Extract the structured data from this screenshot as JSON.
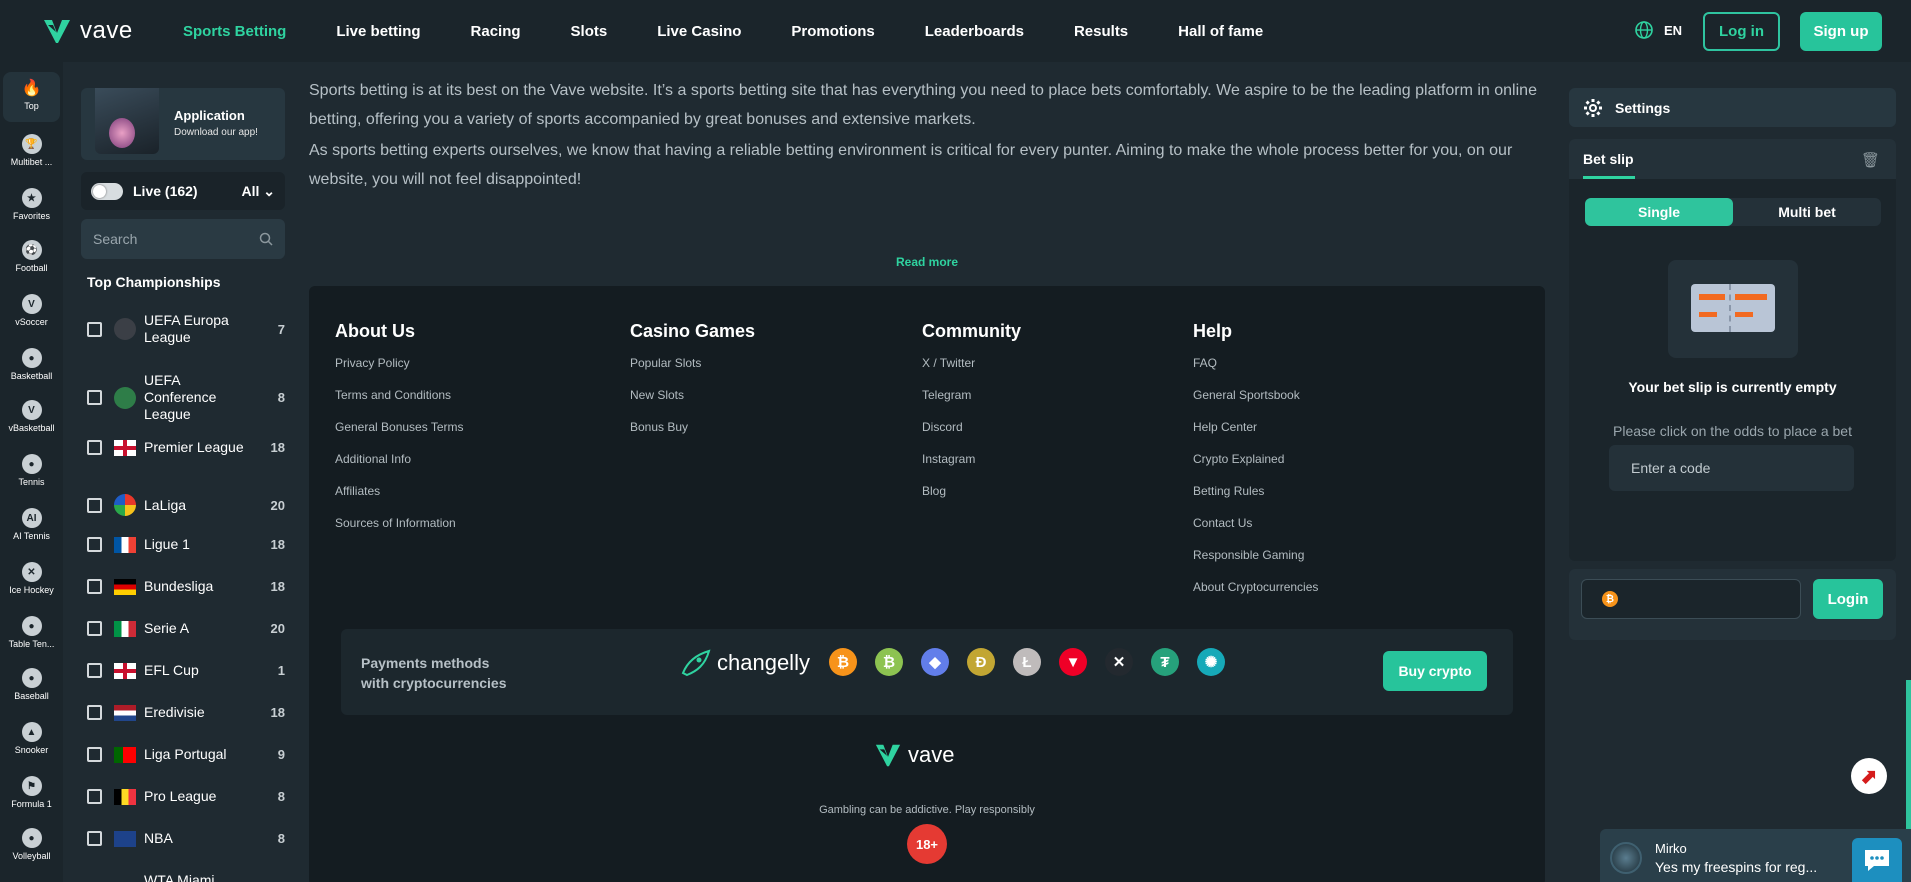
{
  "nav": {
    "logo_text": "vave",
    "links": [
      "Sports Betting",
      "Live betting",
      "Racing",
      "Slots",
      "Live Casino",
      "Promotions",
      "Leaderboards",
      "Results",
      "Hall of fame"
    ],
    "active": "Sports Betting",
    "lang": "EN",
    "login": "Log in",
    "signup": "Sign up"
  },
  "iconbar": [
    {
      "label": "Top",
      "icon": "flame-icon"
    },
    {
      "label": "Multibet ...",
      "icon": "trophy-icon"
    },
    {
      "label": "Favorites",
      "icon": "star-icon"
    },
    {
      "label": "Football",
      "icon": "football-icon"
    },
    {
      "label": "vSoccer",
      "icon": "vsoccer-icon"
    },
    {
      "label": "Basketball",
      "icon": "basketball-icon"
    },
    {
      "label": "vBasketball",
      "icon": "vbasketball-icon"
    },
    {
      "label": "Tennis",
      "icon": "tennis-icon"
    },
    {
      "label": "AI Tennis",
      "icon": "ai-tennis-icon"
    },
    {
      "label": "Ice Hockey",
      "icon": "hockey-icon"
    },
    {
      "label": "Table Ten...",
      "icon": "table-tennis-icon"
    },
    {
      "label": "Baseball",
      "icon": "baseball-icon"
    },
    {
      "label": "Snooker",
      "icon": "snooker-icon"
    },
    {
      "label": "Formula 1",
      "icon": "formula1-icon"
    },
    {
      "label": "Volleyball",
      "icon": "volleyball-icon"
    }
  ],
  "sidebar": {
    "app_title": "Application",
    "app_sub": "Download our app!",
    "live_label": "Live (162)",
    "all_label": "All",
    "search_placeholder": "Search",
    "top_title": "Top Championships",
    "champs": [
      {
        "name": "UEFA Europa League",
        "count": "7"
      },
      {
        "name": "UEFA Conference League",
        "count": "8"
      },
      {
        "name": "Premier League",
        "count": "18"
      },
      {
        "name": "LaLiga",
        "count": "20"
      },
      {
        "name": "Ligue 1",
        "count": "18"
      },
      {
        "name": "Bundesliga",
        "count": "18"
      },
      {
        "name": "Serie A",
        "count": "20"
      },
      {
        "name": "EFL Cup",
        "count": "1"
      },
      {
        "name": "Eredivisie",
        "count": "18"
      },
      {
        "name": "Liga Portugal",
        "count": "9"
      },
      {
        "name": "Pro League",
        "count": "8"
      },
      {
        "name": "NBA",
        "count": "8"
      },
      {
        "name": "WTA Miami",
        "count": ""
      }
    ]
  },
  "main": {
    "para1": "Sports betting is at its best on the Vave website. It’s a sports betting site that has everything you need to place bets comfortably. We aspire to be the leading platform in online betting, offering you a variety of sports accompanied by great bonuses and extensive markets.",
    "para2": "As sports betting experts ourselves, we know that having a reliable betting environment is critical for every punter. Aiming to make the whole process better for you, on our website, you will not feel disappointed!",
    "read_more": "Read more"
  },
  "footer": {
    "columns": [
      {
        "title": "About Us",
        "links": [
          "Privacy Policy",
          "Terms and Conditions",
          "General Bonuses Terms",
          "Additional Info",
          "Affiliates",
          "Sources of Information"
        ]
      },
      {
        "title": "Casino Games",
        "links": [
          "Popular Slots",
          "New Slots",
          "Bonus Buy"
        ]
      },
      {
        "title": "Community",
        "links": [
          "X / Twitter",
          "Telegram",
          "Discord",
          "Instagram",
          "Blog"
        ]
      },
      {
        "title": "Help",
        "links": [
          "FAQ",
          "General Sportsbook",
          "Help Center",
          "Crypto Explained",
          "Betting Rules",
          "Contact Us",
          "Responsible Gaming",
          "About Cryptocurrencies"
        ]
      }
    ],
    "payments_title": "Payments methods with cryptocurrencies",
    "changelly": "changelly",
    "buy_crypto": "Buy crypto",
    "logo_text": "vave",
    "gamble_text": "Gambling can be addictive. Play responsibly",
    "age_badge": "18+",
    "coins": [
      {
        "name": "bitcoin-icon",
        "color": "#f7931a",
        "glyph": "₿"
      },
      {
        "name": "bitcoin-cash-icon",
        "color": "#8dc351",
        "glyph": "₿"
      },
      {
        "name": "ethereum-icon",
        "color": "#627eea",
        "glyph": "◆"
      },
      {
        "name": "dogecoin-icon",
        "color": "#c2a633",
        "glyph": "Ð"
      },
      {
        "name": "litecoin-icon",
        "color": "#bfbbbb",
        "glyph": "Ł"
      },
      {
        "name": "tron-icon",
        "color": "#ef0027",
        "glyph": "▼"
      },
      {
        "name": "xrp-icon",
        "color": "#23292f",
        "glyph": "✕"
      },
      {
        "name": "tether-icon",
        "color": "#26a17b",
        "glyph": "₮"
      },
      {
        "name": "cardano-icon",
        "color": "#16a9b8",
        "glyph": "✺"
      }
    ]
  },
  "right": {
    "settings": "Settings",
    "betslip_title": "Bet slip",
    "tab_single": "Single",
    "tab_multi": "Multi bet",
    "empty_title": "Your bet slip is currently empty",
    "empty_sub": "Please click on the odds to place a bet",
    "code_placeholder": "Enter a code",
    "login_btn": "Login"
  },
  "chat": {
    "name": "Mirko",
    "message": "Yes my freespins for reg..."
  },
  "colors": {
    "accent": "#2fd3a0",
    "button": "#27c49b",
    "age": "#e53a33"
  }
}
